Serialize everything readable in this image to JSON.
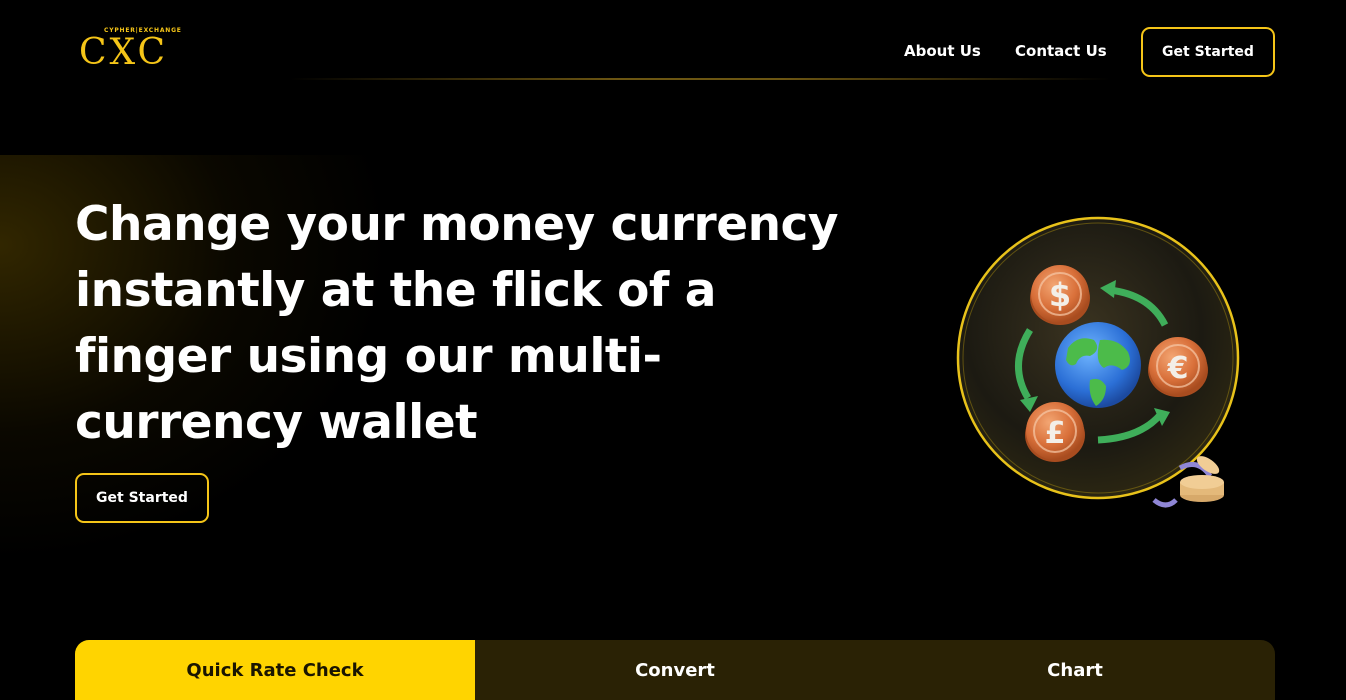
{
  "brand": {
    "tagline": "CYPHER|EXCHANGE",
    "name": "CXC",
    "accent_color": "#f5c518"
  },
  "nav": {
    "links": [
      {
        "label": "About Us"
      },
      {
        "label": "Contact Us"
      }
    ],
    "cta_label": "Get Started"
  },
  "hero": {
    "title": "Change your money currency instantly at the flick of a finger using our multi-currency wallet",
    "cta_label": "Get Started",
    "illustration": {
      "icons": [
        "dollar-coin-icon",
        "euro-coin-icon",
        "pound-coin-icon",
        "globe-icon",
        "exchange-arrows-icon",
        "coin-stack-icon"
      ]
    }
  },
  "tabs": [
    {
      "label": "Quick Rate Check",
      "active": true
    },
    {
      "label": "Convert",
      "active": false
    },
    {
      "label": "Chart",
      "active": false
    }
  ]
}
